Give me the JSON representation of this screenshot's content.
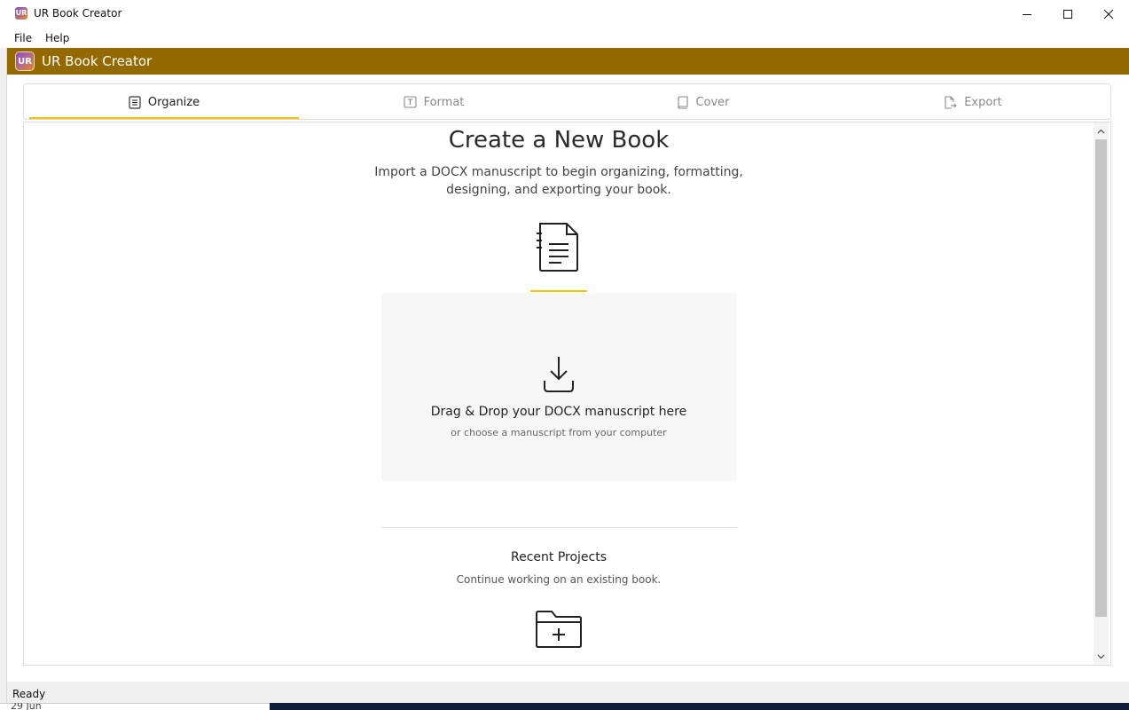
{
  "window": {
    "logo_text": "UR",
    "title": "UR Book Creator"
  },
  "menu": {
    "file": "File",
    "help": "Help"
  },
  "banner": {
    "logo_text": "UR",
    "title": "UR Book Creator",
    "color": "#946a00"
  },
  "tabs": [
    {
      "label": "Organize",
      "icon": "list-document-icon",
      "active": true
    },
    {
      "label": "Format",
      "icon": "text-format-icon",
      "active": false
    },
    {
      "label": "Cover",
      "icon": "book-icon",
      "active": false
    },
    {
      "label": "Export",
      "icon": "export-file-icon",
      "active": false
    }
  ],
  "main": {
    "title": "Create a New Book",
    "subtitle_line1": "Import a DOCX manuscript to begin organizing, formatting,",
    "subtitle_line2": "designing, and exporting your book.",
    "dropzone_title": "Drag & Drop your DOCX manuscript here",
    "dropzone_subtitle": "or choose a manuscript from your computer",
    "recent_title": "Recent Projects",
    "recent_subtitle": "Continue working on an existing book."
  },
  "status": {
    "text": "Ready"
  },
  "background_window": {
    "text": "29 Jun"
  },
  "colors": {
    "accent": "#f2c200",
    "banner": "#946a00"
  }
}
